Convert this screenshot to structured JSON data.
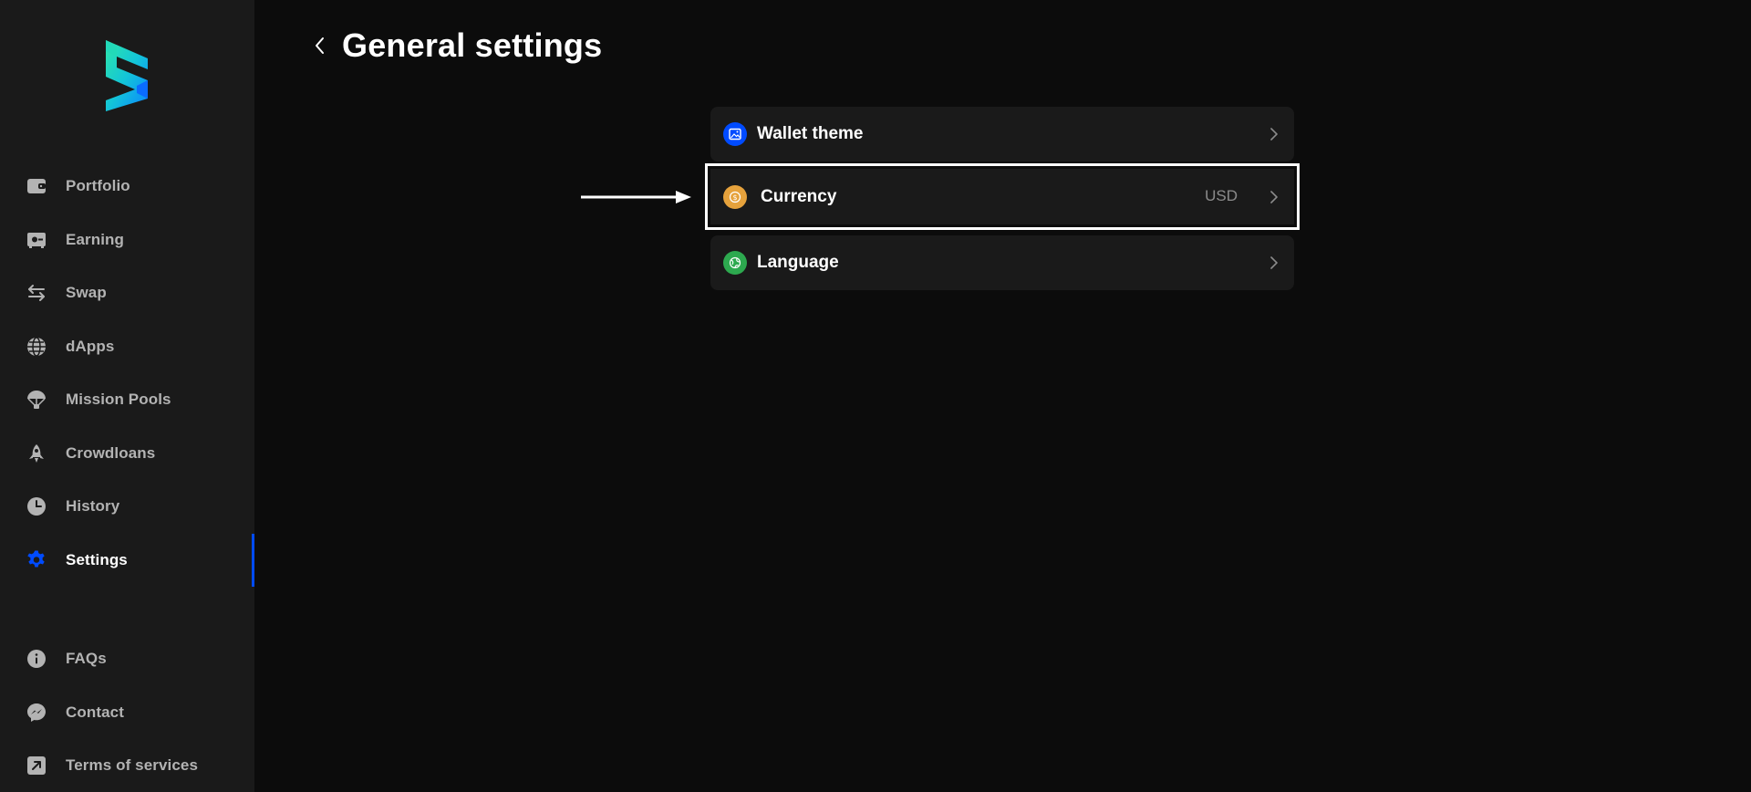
{
  "colors": {
    "accent": "#004bff",
    "background": "#0c0c0c",
    "sidebar_bg": "#1a1a1a",
    "row_bg": "#1a1a1a",
    "muted_text": "#b3b3b3",
    "wallet_theme_icon": "#004bff",
    "currency_icon": "#e6a23c",
    "language_icon": "#2da94f"
  },
  "sidebar": {
    "logo": "subwallet-logo",
    "items": [
      {
        "label": "Portfolio",
        "icon": "wallet-icon"
      },
      {
        "label": "Earning",
        "icon": "safe-icon"
      },
      {
        "label": "Swap",
        "icon": "arrows-swap-icon"
      },
      {
        "label": "dApps",
        "icon": "globe-icon"
      },
      {
        "label": "Mission Pools",
        "icon": "parachute-icon"
      },
      {
        "label": "Crowdloans",
        "icon": "rocket-icon"
      },
      {
        "label": "History",
        "icon": "clock-icon"
      },
      {
        "label": "Settings",
        "icon": "gear-icon",
        "active": true
      }
    ],
    "footer_items": [
      {
        "label": "FAQs",
        "icon": "info-icon"
      },
      {
        "label": "Contact",
        "icon": "messenger-icon"
      },
      {
        "label": "Terms of services",
        "icon": "external-link-icon"
      }
    ]
  },
  "header": {
    "back_icon": "chevron-left-icon",
    "title": "General settings"
  },
  "settings": [
    {
      "label": "Wallet theme",
      "value": "",
      "icon": "image-icon"
    },
    {
      "label": "Currency",
      "value": "USD",
      "icon": "dollar-coin-icon",
      "highlighted": true
    },
    {
      "label": "Language",
      "value": "",
      "icon": "globe-icon"
    }
  ]
}
